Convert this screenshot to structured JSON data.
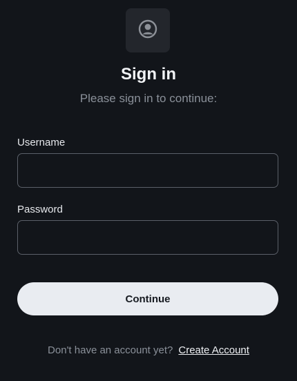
{
  "header": {
    "logo_icon": "user-circle-icon",
    "title": "Sign in",
    "subtitle": "Please sign in to continue:"
  },
  "form": {
    "username_label": "Username",
    "username_value": "",
    "password_label": "Password",
    "password_value": "",
    "continue_label": "Continue"
  },
  "footer": {
    "prompt": "Don't have an account yet?",
    "create_account_label": "Create Account"
  },
  "colors": {
    "background": "#12151a",
    "logo_box": "#23262c",
    "button_bg": "#e9ecf1",
    "muted_text": "#8a9099"
  }
}
